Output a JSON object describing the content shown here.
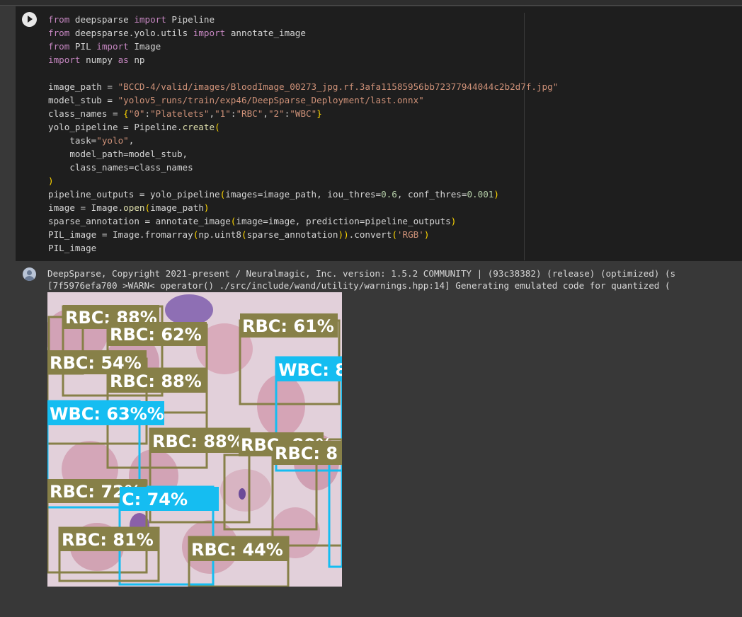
{
  "code_lines": [
    [
      {
        "t": "from",
        "c": "kw"
      },
      {
        "t": " deepsparse ",
        "c": "var"
      },
      {
        "t": "import",
        "c": "kw"
      },
      {
        "t": " Pipeline",
        "c": "var"
      }
    ],
    [
      {
        "t": "from",
        "c": "kw"
      },
      {
        "t": " deepsparse.yolo.utils ",
        "c": "var"
      },
      {
        "t": "import",
        "c": "kw"
      },
      {
        "t": " annotate_image",
        "c": "var"
      }
    ],
    [
      {
        "t": "from",
        "c": "kw"
      },
      {
        "t": " PIL ",
        "c": "var"
      },
      {
        "t": "import",
        "c": "kw"
      },
      {
        "t": " Image",
        "c": "var"
      }
    ],
    [
      {
        "t": "import",
        "c": "kw"
      },
      {
        "t": " numpy ",
        "c": "var"
      },
      {
        "t": "as",
        "c": "kw"
      },
      {
        "t": " np",
        "c": "var"
      }
    ],
    [],
    [
      {
        "t": "image_path = ",
        "c": "var"
      },
      {
        "t": "\"BCCD-4/valid/images/BloodImage_00273_jpg.rf.3afa11585956bb72377944044c2b2d7f.jpg\"",
        "c": "str"
      }
    ],
    [
      {
        "t": "model_stub = ",
        "c": "var"
      },
      {
        "t": "\"yolov5_runs/train/exp46/DeepSparse_Deployment/last.onnx\"",
        "c": "str"
      }
    ],
    [
      {
        "t": "class_names = ",
        "c": "var"
      },
      {
        "t": "{",
        "c": "br"
      },
      {
        "t": "\"0\"",
        "c": "str"
      },
      {
        "t": ":",
        "c": "var"
      },
      {
        "t": "\"Platelets\"",
        "c": "str"
      },
      {
        "t": ",",
        "c": "var"
      },
      {
        "t": "\"1\"",
        "c": "str"
      },
      {
        "t": ":",
        "c": "var"
      },
      {
        "t": "\"RBC\"",
        "c": "str"
      },
      {
        "t": ",",
        "c": "var"
      },
      {
        "t": "\"2\"",
        "c": "str"
      },
      {
        "t": ":",
        "c": "var"
      },
      {
        "t": "\"WBC\"",
        "c": "str"
      },
      {
        "t": "}",
        "c": "br"
      }
    ],
    [
      {
        "t": "yolo_pipeline = Pipeline.",
        "c": "var"
      },
      {
        "t": "create",
        "c": "fn"
      },
      {
        "t": "(",
        "c": "br"
      }
    ],
    [
      {
        "t": "    task=",
        "c": "var"
      },
      {
        "t": "\"yolo\"",
        "c": "str"
      },
      {
        "t": ",",
        "c": "var"
      }
    ],
    [
      {
        "t": "    model_path=model_stub,",
        "c": "var"
      }
    ],
    [
      {
        "t": "    class_names=class_names",
        "c": "var"
      }
    ],
    [
      {
        "t": ")",
        "c": "br"
      }
    ],
    [
      {
        "t": "pipeline_outputs = yolo_pipeline",
        "c": "var"
      },
      {
        "t": "(",
        "c": "br"
      },
      {
        "t": "images=image_path, iou_thres=",
        "c": "var"
      },
      {
        "t": "0.6",
        "c": "num"
      },
      {
        "t": ", conf_thres=",
        "c": "var"
      },
      {
        "t": "0.001",
        "c": "num"
      },
      {
        "t": ")",
        "c": "br"
      }
    ],
    [
      {
        "t": "image = Image.",
        "c": "var"
      },
      {
        "t": "open",
        "c": "fn"
      },
      {
        "t": "(",
        "c": "br"
      },
      {
        "t": "image_path",
        "c": "var"
      },
      {
        "t": ")",
        "c": "br"
      }
    ],
    [
      {
        "t": "sparse_annotation = annotate_image",
        "c": "var"
      },
      {
        "t": "(",
        "c": "br"
      },
      {
        "t": "image=image, prediction=pipeline_outputs",
        "c": "var"
      },
      {
        "t": ")",
        "c": "br"
      }
    ],
    [
      {
        "t": "PIL_image = Image.fromarray",
        "c": "var"
      },
      {
        "t": "(",
        "c": "br"
      },
      {
        "t": "np.uint8",
        "c": "var"
      },
      {
        "t": "(",
        "c": "br"
      },
      {
        "t": "sparse_annotation",
        "c": "var"
      },
      {
        "t": "))",
        "c": "br"
      },
      {
        "t": ".convert",
        "c": "var"
      },
      {
        "t": "(",
        "c": "br"
      },
      {
        "t": "'RGB'",
        "c": "str"
      },
      {
        "t": ")",
        "c": "br"
      }
    ],
    [
      {
        "t": "PIL_image",
        "c": "var"
      }
    ]
  ],
  "output": {
    "line1": "DeepSparse, Copyright 2021-present / Neuralmagic, Inc. version: 1.5.2 COMMUNITY | (93c38382) (release) (optimized) (s",
    "line2": "[7f5976efa700 >WARN<  operator() ./src/include/wand/utility/warnings.hpp:14] Generating emulated code for quantized ("
  },
  "colors": {
    "rbc": "#878048",
    "wbc": "#15bdf1",
    "text": "#ffffff"
  },
  "detections": [
    {
      "text": "RBC: 88%",
      "cls": "rbc"
    },
    {
      "text": "RBC: 62%",
      "cls": "rbc"
    },
    {
      "text": "RBC: 61%",
      "cls": "rbc"
    },
    {
      "text": "RBC: 54%",
      "cls": "rbc"
    },
    {
      "text": "WBC: 8",
      "cls": "wbc"
    },
    {
      "text": "RBC: 88%",
      "cls": "rbc"
    },
    {
      "text": "WBC: 63%%",
      "cls": "wbc"
    },
    {
      "text": "RBC: 88%",
      "cls": "rbc"
    },
    {
      "text": "RBC: 80%",
      "cls": "rbc"
    },
    {
      "text": "RBC: 8",
      "cls": "rbc"
    },
    {
      "text": "RBC: 72%",
      "cls": "rbc"
    },
    {
      "text": "C: 74%",
      "cls": "wbc"
    },
    {
      "text": "RBC: 81%",
      "cls": "rbc"
    },
    {
      "text": "RBC: 44%",
      "cls": "rbc"
    }
  ]
}
